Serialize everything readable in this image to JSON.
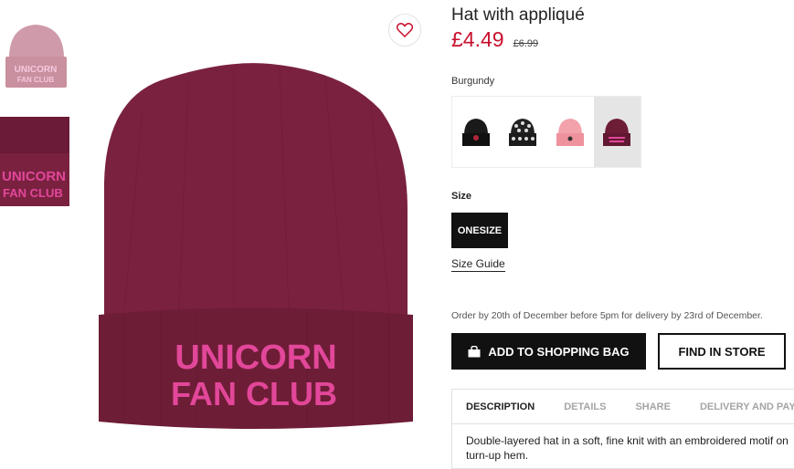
{
  "product": {
    "title": "Hat with appliqué",
    "price_sale": "£4.49",
    "price_old": "£6.99",
    "selected_color": "Burgundy",
    "hat_text_line1": "UNICORN",
    "hat_text_line2": "FAN CLUB"
  },
  "swatches": [
    {
      "name": "black-hat",
      "color": "#1a1a1a",
      "selected": false
    },
    {
      "name": "patterned-hat",
      "color": "#222222",
      "selected": false
    },
    {
      "name": "pink-hat",
      "color": "#f3a2ac",
      "selected": false
    },
    {
      "name": "burgundy-hat",
      "color": "#6e1d36",
      "selected": true
    }
  ],
  "size": {
    "label": "Size",
    "option": "ONESIZE",
    "guide_label": "Size Guide"
  },
  "delivery_note": "Order by 20th of December before 5pm for delivery by 23rd of December.",
  "actions": {
    "add_to_bag": "ADD TO SHOPPING BAG",
    "find_in_store": "FIND IN STORE"
  },
  "tabs": [
    {
      "label": "DESCRIPTION",
      "active": true
    },
    {
      "label": "DETAILS",
      "active": false
    },
    {
      "label": "SHARE",
      "active": false
    },
    {
      "label": "DELIVERY AND PAYMENT",
      "active": false
    }
  ],
  "description": "Double-layered hat in a soft, fine knit with an embroidered motif on turn-up hem.",
  "icons": [
    "heart-icon",
    "bag-icon"
  ],
  "colors": {
    "price_sale": "#c8102e",
    "hat_main": "#7a2140",
    "hat_text": "#e2479a",
    "thumb_pink": "#cf9aaa"
  }
}
